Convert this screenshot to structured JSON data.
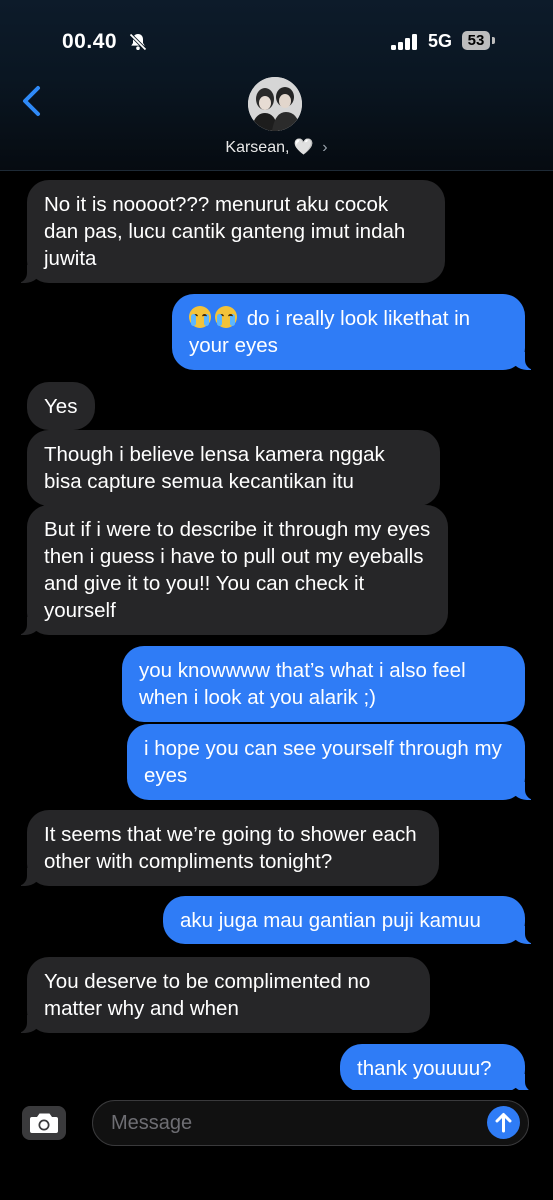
{
  "status_bar": {
    "time": "00.40",
    "network": "5G",
    "battery": "53"
  },
  "header": {
    "contact_name": "Karsean,",
    "heart": "🤍",
    "chevron": "›"
  },
  "messages": [
    {
      "side": "in",
      "text": "No it is noooot??? menurut aku cocok dan pas, lucu cantik ganteng imut indah juwita"
    },
    {
      "side": "out",
      "text": "do i really look likethat in your eyes"
    },
    {
      "side": "in",
      "text": "Yes"
    },
    {
      "side": "in",
      "text": "Though i believe lensa kamera nggak bisa capture semua kecantikan itu"
    },
    {
      "side": "in",
      "text": "But if i were to describe it through my eyes then i guess i have to pull out my eyeballs and give it to you!! You can check it yourself"
    },
    {
      "side": "out",
      "text": "you knowwww that’s what i also feel when i look at you alarik ;)"
    },
    {
      "side": "out",
      "text": "i hope you can see yourself through my eyes"
    },
    {
      "side": "in",
      "text": "It seems that we’re going to shower each other with compliments tonight?"
    },
    {
      "side": "out",
      "text": "aku juga mau gantian puji kamuu"
    },
    {
      "side": "in",
      "text": "You deserve to be complimented no matter why and when"
    },
    {
      "side": "out",
      "text": "thank youuuu?"
    }
  ],
  "input": {
    "placeholder": "Message"
  },
  "colors": {
    "incoming_bubble": "#262628",
    "outgoing_bubble": "#2f7cf6",
    "accent": "#2f7cf6"
  },
  "icons": [
    "bell-slash-icon",
    "signal-icon",
    "back-chevron-icon",
    "camera-icon",
    "send-arrow-icon",
    "loudly-crying-face-emoji"
  ]
}
